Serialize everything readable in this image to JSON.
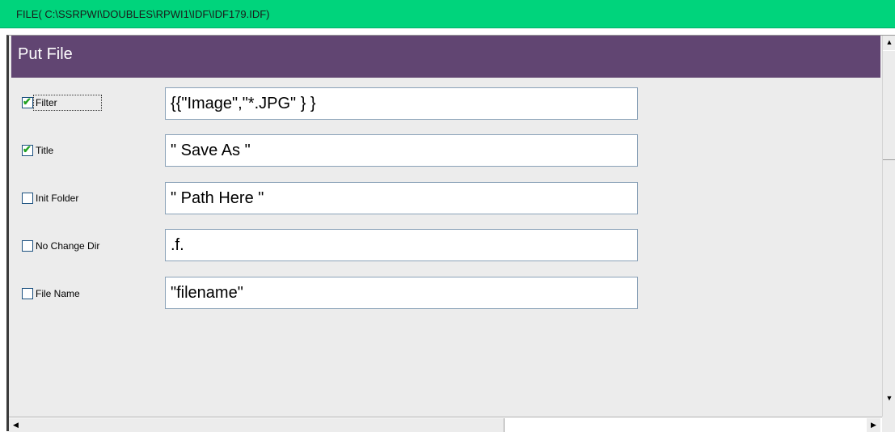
{
  "window": {
    "title": "FILE( C:\\SSRPWI\\DOUBLES\\RPWI1\\IDF\\IDF179.IDF)"
  },
  "panel": {
    "title": "Put File"
  },
  "fields": [
    {
      "label": "Filter",
      "checked": true,
      "value": "{{\"Image\",\"*.JPG\" } }"
    },
    {
      "label": "Title",
      "checked": true,
      "value": "\" Save As \""
    },
    {
      "label": "Init Folder",
      "checked": false,
      "value": "\" Path Here \""
    },
    {
      "label": "No Change Dir",
      "checked": false,
      "value": ".f."
    },
    {
      "label": "File Name",
      "checked": false,
      "value": "\"filename\""
    }
  ],
  "icons": {
    "check": "✔",
    "scroll_up": "▲",
    "scroll_down": "▼",
    "scroll_left": "◀",
    "scroll_right": "▶"
  },
  "colors": {
    "titlebar": "#00d47c",
    "header": "#614572",
    "background": "#ececec"
  }
}
